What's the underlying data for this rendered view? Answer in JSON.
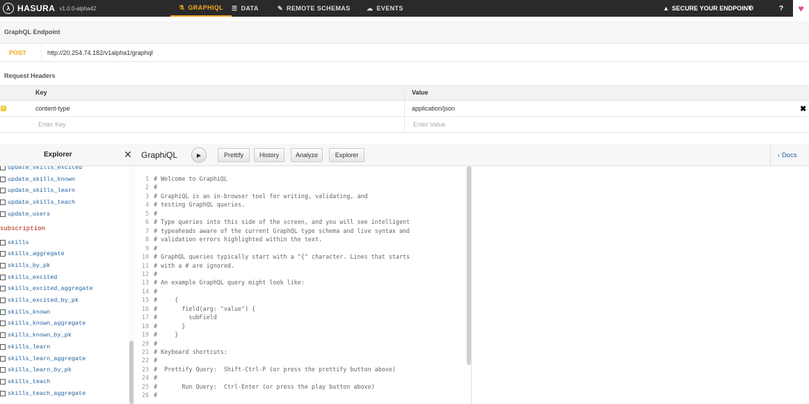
{
  "topbar": {
    "brand": "HASURA",
    "version": "v1.0.0-alpha42",
    "tabs": [
      {
        "label": "GRAPHIQL",
        "icon": "flask-icon"
      },
      {
        "label": "DATA",
        "icon": "database-icon"
      },
      {
        "label": "REMOTE SCHEMAS",
        "icon": "plug-icon"
      },
      {
        "label": "EVENTS",
        "icon": "cloud-icon"
      }
    ],
    "secure": "SECURE YOUR ENDPOINT",
    "help": "?"
  },
  "endpoint": {
    "section_label": "GraphQL Endpoint",
    "method": "POST",
    "url": "http://20.254.74.182/v1alpha1/graphql"
  },
  "headers": {
    "section_label": "Request Headers",
    "key_col": "Key",
    "value_col": "Value",
    "rows": [
      {
        "key": "content-type",
        "value": "application/json"
      }
    ],
    "key_placeholder": "Enter Key",
    "value_placeholder": "Enter Value"
  },
  "explorer": {
    "title": "Explorer",
    "mutation_fields": [
      "update_skills_excited",
      "update_skills_known",
      "update_skills_learn",
      "update_skills_teach",
      "update_users"
    ],
    "subscription_label": "subscription",
    "subscription_fields": [
      "skills",
      "skills_aggregate",
      "skills_by_pk",
      "skills_excited",
      "skills_excited_aggregate",
      "skills_excited_by_pk",
      "skills_known",
      "skills_known_aggregate",
      "skills_known_by_pk",
      "skills_learn",
      "skills_learn_aggregate",
      "skills_learn_by_pk",
      "skills_teach",
      "skills_teach_aggregate"
    ]
  },
  "graphiql": {
    "title_prefix": "Graph",
    "title_italic": "i",
    "title_suffix": "QL",
    "buttons": [
      "Prettify",
      "History",
      "Analyze",
      "Explorer"
    ],
    "docs": "Docs",
    "lines": [
      "# Welcome to GraphiQL",
      "#",
      "# GraphiQL is an in-browser tool for writing, validating, and",
      "# testing GraphQL queries.",
      "#",
      "# Type queries into this side of the screen, and you will see intelligent",
      "# typeaheads aware of the current GraphQL type schema and live syntax and",
      "# validation errors highlighted within the text.",
      "#",
      "# GraphQL queries typically start with a \"{\" character. Lines that starts",
      "# with a # are ignored.",
      "#",
      "# An example GraphQL query might look like:",
      "#",
      "#     {",
      "#       field(arg: \"value\") {",
      "#         subField",
      "#       }",
      "#     }",
      "#",
      "# Keyboard shortcuts:",
      "#",
      "#  Prettify Query:  Shift-Ctrl-P (or press the prettify button above)",
      "#",
      "#       Run Query:  Ctrl-Enter (or press the play button above)",
      "#"
    ]
  }
}
